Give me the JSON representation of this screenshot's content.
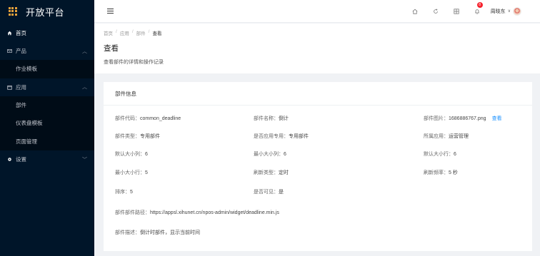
{
  "app": {
    "title": "开放平台"
  },
  "sidebar": {
    "items": [
      {
        "label": "首页",
        "icon": "home-icon"
      },
      {
        "label": "产品",
        "icon": "mail-icon",
        "expanded": true,
        "children": [
          {
            "label": "作业模板"
          }
        ]
      },
      {
        "label": "应用",
        "icon": "calendar-icon",
        "expanded": true,
        "children": [
          {
            "label": "部件"
          },
          {
            "label": "仪表盘模板"
          },
          {
            "label": "页面管理"
          }
        ]
      },
      {
        "label": "设置",
        "icon": "gear-icon",
        "expanded": false
      }
    ]
  },
  "topbar": {
    "notification_count": "8",
    "user_name": "周晓东"
  },
  "breadcrumb": [
    "首页",
    "应用",
    "部件",
    "查看"
  ],
  "page": {
    "title": "查看",
    "description": "查看部件的详情和操作记录"
  },
  "card": {
    "title": "部件信息",
    "fields": {
      "code": {
        "label": "部件代码：",
        "value": "common_deadline"
      },
      "name": {
        "label": "部件名称：",
        "value": "倒计"
      },
      "image": {
        "label": "部件图片：",
        "value": "1686886767.png",
        "action": "查看"
      },
      "type": {
        "label": "部件类型：",
        "value": "专用部件"
      },
      "apply_to": {
        "label": "是否应用专用：",
        "value": "专用部件"
      },
      "scope": {
        "label": "所属应用：",
        "value": "运营管理"
      },
      "default_width": {
        "label": "默认大小列：",
        "value": "6"
      },
      "min_width": {
        "label": "最小大小列：",
        "value": "6"
      },
      "default_height": {
        "label": "默认大小行：",
        "value": "6"
      },
      "min_height": {
        "label": "最小大小行：",
        "value": "5"
      },
      "refresh_type": {
        "label": "刷新类型：",
        "value": "定时"
      },
      "refresh_rate": {
        "label": "刷新频率：",
        "value": "5 秒"
      },
      "sort": {
        "label": "排序：",
        "value": "5"
      },
      "enabled": {
        "label": "是否可见：",
        "value": "是"
      },
      "path": {
        "label": "部件部件路径：",
        "value": "https://appsl.xihunet.cn/npos-admin/widget/deadline.min.js"
      },
      "desc": {
        "label": "部件描述：",
        "value": "倒计时部件，显示当前时间"
      }
    }
  }
}
